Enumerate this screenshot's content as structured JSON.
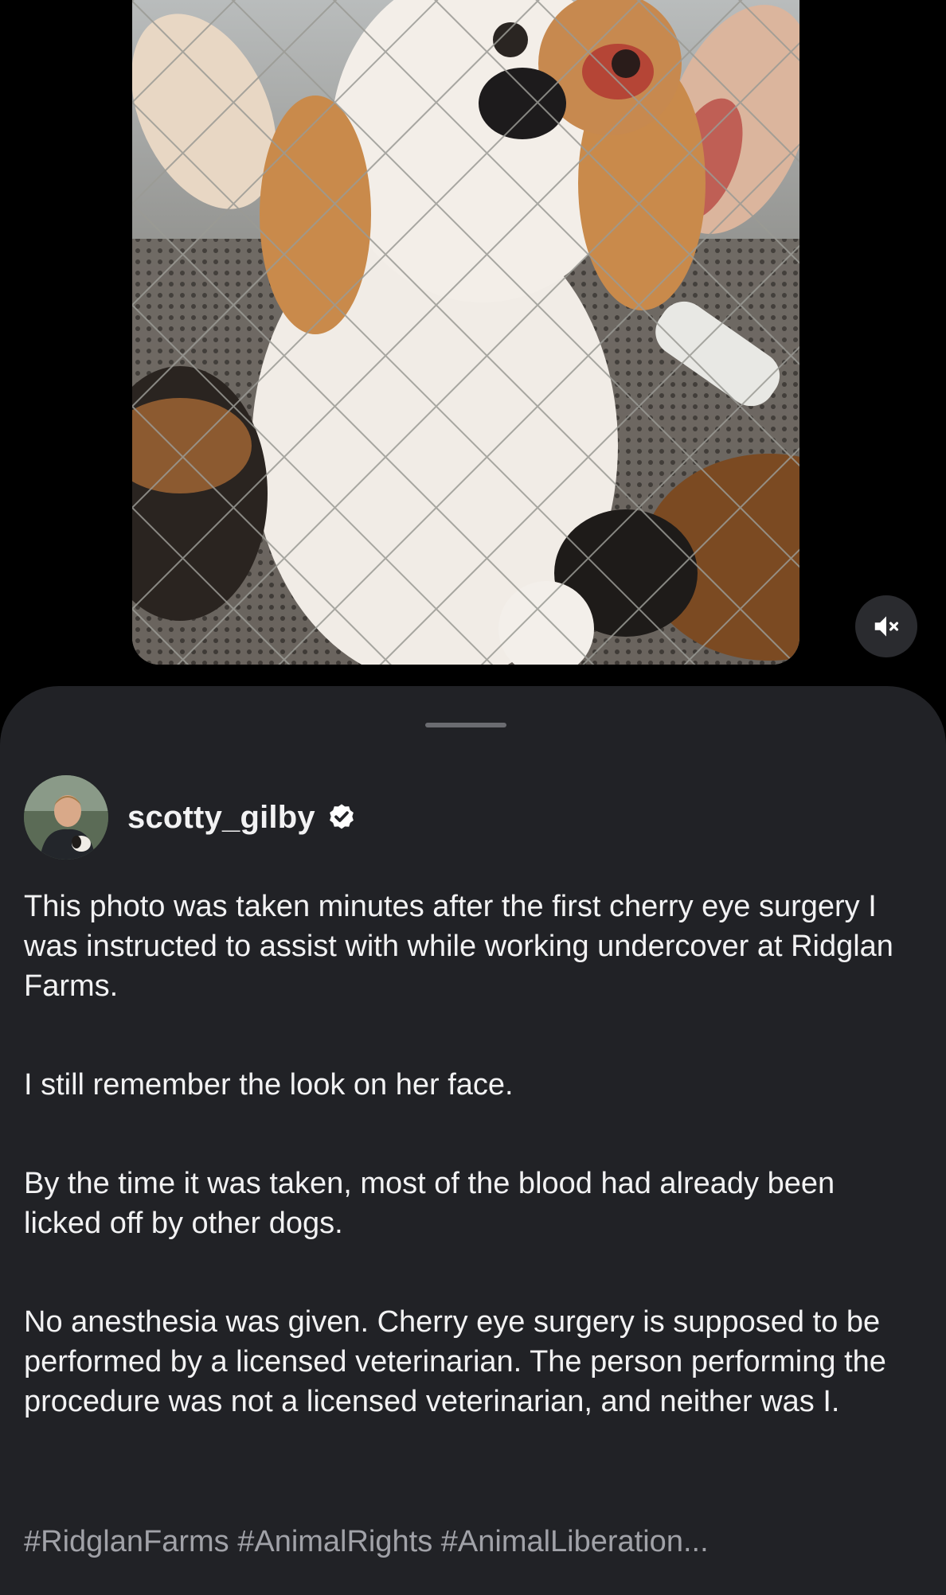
{
  "media": {
    "description_icon": "video-frame",
    "mute_icon": "speaker-muted-icon"
  },
  "post": {
    "username": "scotty_gilby",
    "verified_icon": "verified-badge-icon",
    "paragraphs": [
      "This photo was taken minutes after the first cherry eye surgery I was instructed to assist with while working undercover at Ridglan Farms.",
      "I still remember the look on her face.",
      "By the time it was taken, most of the blood had already been licked off by other dogs.",
      "No anesthesia was given. Cherry eye surgery is supposed to be performed by a licensed veterinarian. The person performing the procedure was not a licensed veterinarian, and neither was I."
    ],
    "hashtags": "#RidglanFarms #AnimalRights #AnimalLiberation..."
  },
  "colors": {
    "background": "#000000",
    "sheet": "#212226",
    "text": "#f2f2f3",
    "hashtag": "#a1a2a8"
  }
}
